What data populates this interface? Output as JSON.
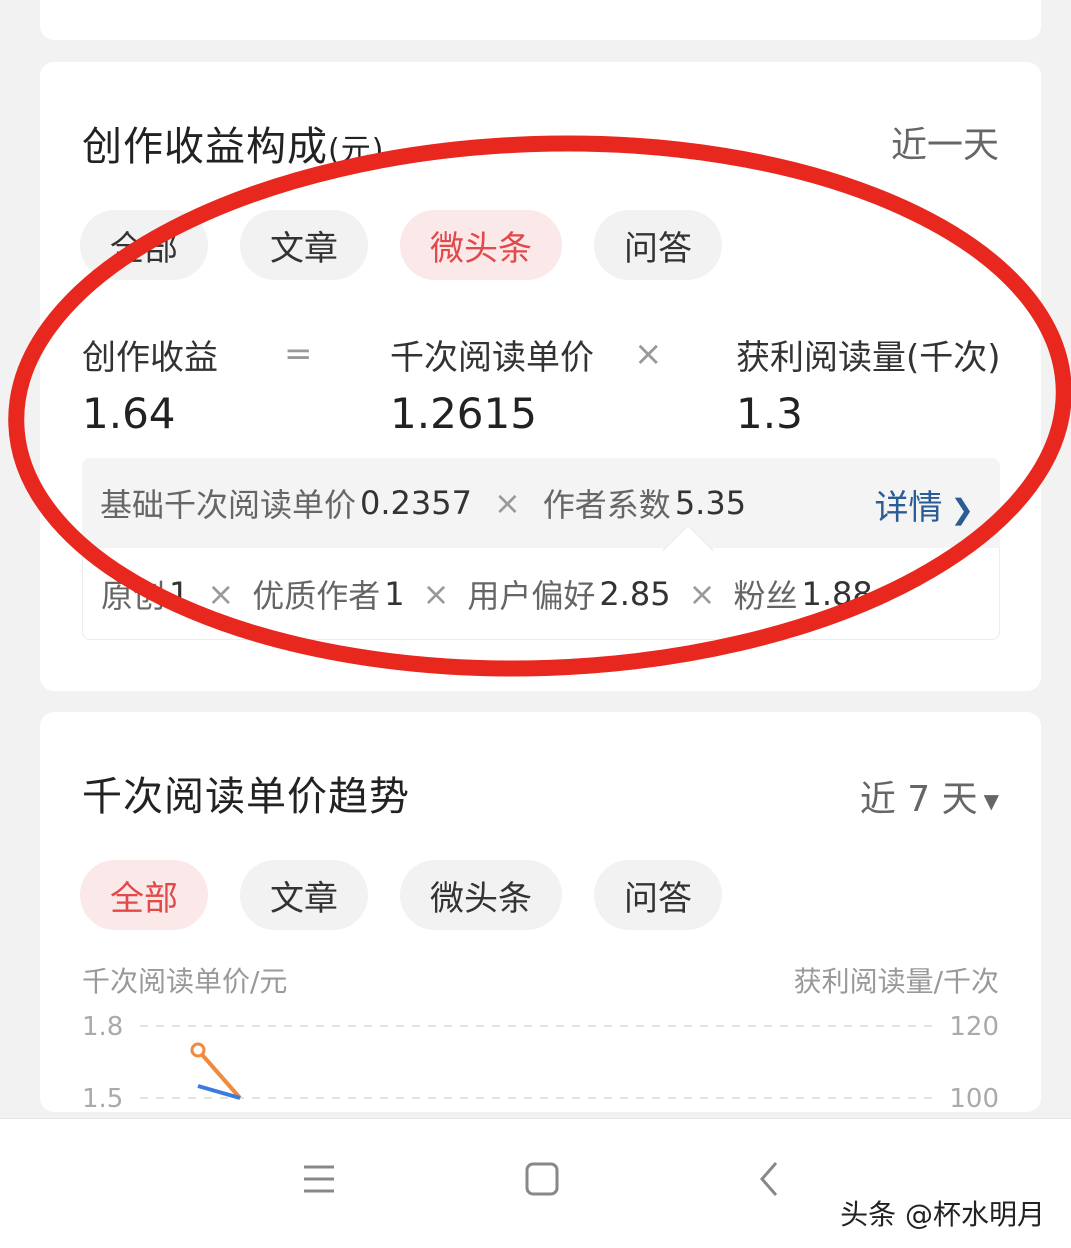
{
  "income_card": {
    "title": "创作收益构成",
    "title_unit": "(元)",
    "range": "近一天",
    "tabs": [
      {
        "label": "全部",
        "active": false
      },
      {
        "label": "文章",
        "active": false
      },
      {
        "label": "微头条",
        "active": true
      },
      {
        "label": "问答",
        "active": false
      }
    ],
    "formula": {
      "income_label": "创作收益",
      "income_value": "1.64",
      "equals": "=",
      "rpm_label": "千次阅读单价",
      "rpm_value": "1.2615",
      "times": "×",
      "reads_label": "获利阅读量(千次)",
      "reads_value": "1.3"
    },
    "detail": {
      "base_label": "基础千次阅读单价",
      "base_value": "0.2357",
      "times": "×",
      "coef_label": "作者系数",
      "coef_value": "5.35",
      "link": "详情"
    },
    "factors": [
      {
        "label": "原创",
        "value": "1"
      },
      {
        "label": "优质作者",
        "value": "1"
      },
      {
        "label": "用户偏好",
        "value": "2.85"
      },
      {
        "label": "粉丝",
        "value": "1.88"
      }
    ],
    "factor_times": "×"
  },
  "trend_card": {
    "title": "千次阅读单价趋势",
    "range": "近 7 天",
    "tabs": [
      {
        "label": "全部",
        "active": true
      },
      {
        "label": "文章",
        "active": false
      },
      {
        "label": "微头条",
        "active": false
      },
      {
        "label": "问答",
        "active": false
      }
    ],
    "left_axis_label": "千次阅读单价/元",
    "right_axis_label": "获利阅读量/千次"
  },
  "chart_data": {
    "type": "line",
    "left_ticks": [
      "1.8",
      "1.5"
    ],
    "right_ticks": [
      "120",
      "100"
    ],
    "ylim_left": [
      1.5,
      1.8
    ],
    "ylim_right": [
      100,
      120
    ],
    "series": [
      {
        "color": "#f08a3c",
        "x": [
          1,
          2
        ],
        "y": [
          1.7,
          1.5
        ]
      },
      {
        "color": "#3a7be0",
        "x": [
          1,
          2
        ],
        "y": [
          1.55,
          1.5
        ]
      }
    ],
    "grid": true
  },
  "nav": {
    "menu_icon": "menu-icon",
    "home_icon": "home-icon",
    "back_icon": "back-icon"
  },
  "watermark": "头条 @杯水明月",
  "colors": {
    "accent_red": "#e04a4a",
    "link_blue": "#2a5d96",
    "annotation_red": "#e8281e"
  }
}
